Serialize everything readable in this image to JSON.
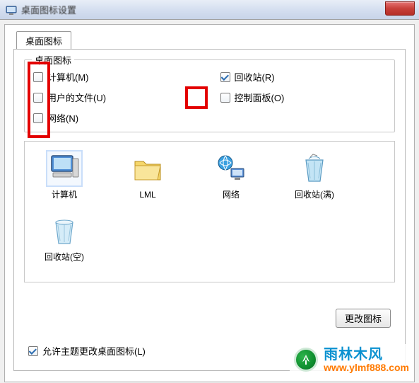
{
  "window": {
    "title": "桌面图标设置"
  },
  "tab": {
    "label": "桌面图标"
  },
  "groupbox": {
    "title": "桌面图标"
  },
  "checkboxes": {
    "computer": {
      "label": "计算机(M)",
      "checked": false
    },
    "recyclebin": {
      "label": "回收站(R)",
      "checked": true
    },
    "userfiles": {
      "label": "用户的文件(U)",
      "checked": false
    },
    "controlpanel": {
      "label": "控制面板(O)",
      "checked": false
    },
    "network": {
      "label": "网络(N)",
      "checked": false
    }
  },
  "icons": {
    "computer": "计算机",
    "lml": "LML",
    "network": "网络",
    "recyclebin_full": "回收站(满)",
    "recyclebin_empty": "回收站(空)"
  },
  "buttons": {
    "change_icon": "更改图标"
  },
  "theme_checkbox": {
    "label": "允许主题更改桌面图标(L)",
    "checked": true
  },
  "watermark": {
    "cn": "雨林木风",
    "url": "www.ylmf888.com"
  }
}
